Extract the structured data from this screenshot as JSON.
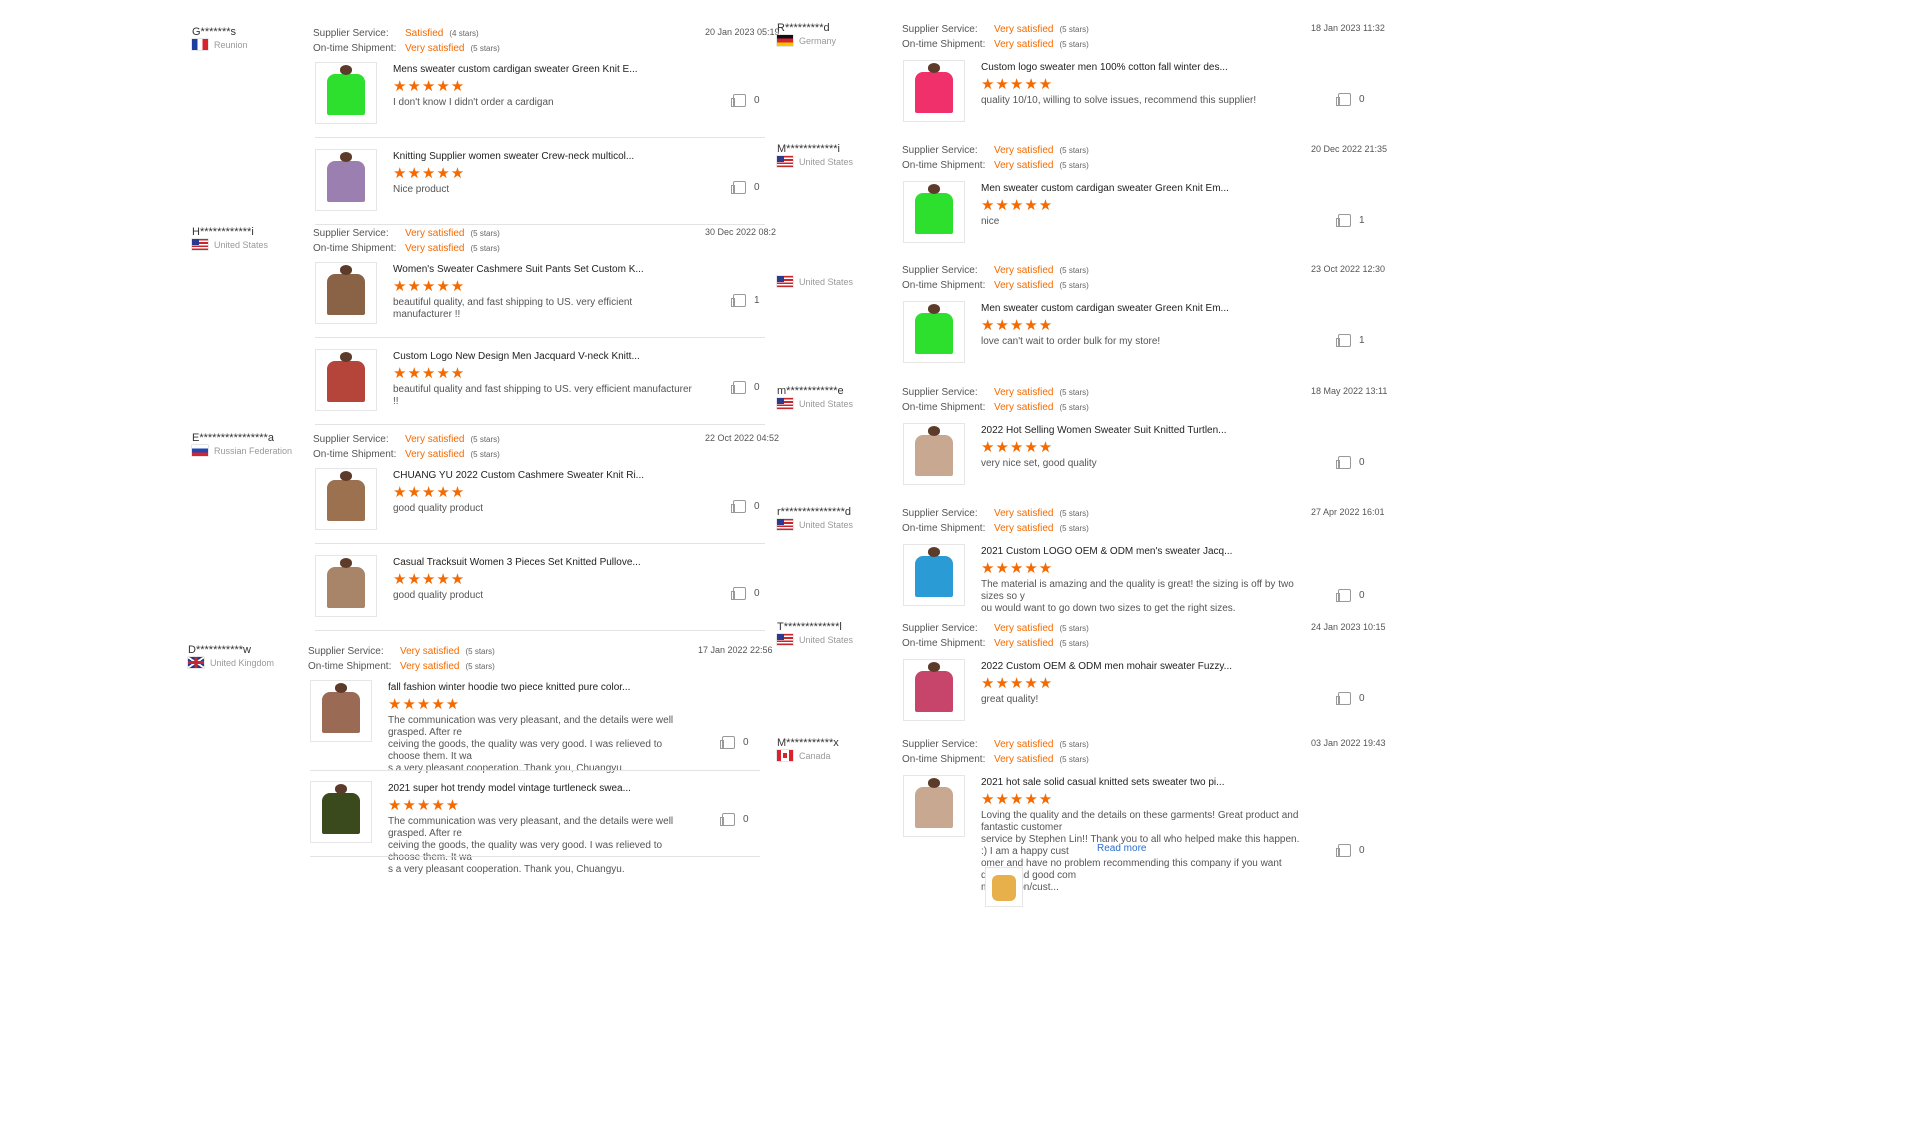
{
  "labels": {
    "supplier_service": "Supplier Service:",
    "ontime_shipment": "On-time Shipment:",
    "read_more": "Read more"
  },
  "colors": {
    "accent": "#f56a00",
    "link": "#2a6fd0"
  },
  "left": [
    {
      "name": "G*******s",
      "country": "Reunion",
      "flag": "fr",
      "service": "Satisfied",
      "service_stars": "(4 stars)",
      "shipment": "Very satisfied",
      "shipment_stars": "(5 stars)",
      "date": "20 Jan 2023 05:19",
      "items": [
        {
          "title": "Mens sweater custom cardigan sweater Green Knit E...",
          "stars": "★★★★★",
          "text": "I don't know I didn't order a cardigan",
          "likes": "0",
          "color": "#2de02d"
        },
        {
          "title": "Knitting Supplier women sweater Crew-neck multicol...",
          "stars": "★★★★★",
          "text": "Nice product",
          "likes": "0",
          "color": "#9b7fb0"
        }
      ]
    },
    {
      "name": "H************i",
      "country": "United States",
      "flag": "us",
      "service": "Very satisfied",
      "service_stars": "(5 stars)",
      "shipment": "Very satisfied",
      "shipment_stars": "(5 stars)",
      "date": "30 Dec 2022 08:2",
      "items": [
        {
          "title": "Women's Sweater Cashmere Suit Pants Set Custom K...",
          "stars": "★★★★★",
          "text": "beautiful quality, and fast shipping to US. very efficient manufacturer !!",
          "likes": "1",
          "color": "#8a6246"
        },
        {
          "title": "Custom Logo New Design Men Jacquard V-neck Knitt...",
          "stars": "★★★★★",
          "text": "beautiful quality and fast shipping to US. very efficient manufacturer !!",
          "likes": "0",
          "color": "#b5453a"
        }
      ]
    },
    {
      "name": "E****************a",
      "country": "Russian Federation",
      "flag": "ru",
      "service": "Very satisfied",
      "service_stars": "(5 stars)",
      "shipment": "Very satisfied",
      "shipment_stars": "(5 stars)",
      "date": "22 Oct 2022 04:52",
      "items": [
        {
          "title": "CHUANG YU 2022 Custom Cashmere Sweater Knit Ri...",
          "stars": "★★★★★",
          "text": "good quality product",
          "likes": "0",
          "color": "#9b7150"
        },
        {
          "title": "Casual Tracksuit Women 3 Pieces Set Knitted Pullove...",
          "stars": "★★★★★",
          "text": "good quality product",
          "likes": "0",
          "color": "#a88468"
        }
      ]
    },
    {
      "name": "D***********w",
      "country": "United Kingdom",
      "flag": "gb",
      "service": "Very satisfied",
      "service_stars": "(5 stars)",
      "shipment": "Very satisfied",
      "shipment_stars": "(5 stars)",
      "date": "17 Jan 2022 22:56",
      "items": [
        {
          "title": "fall fashion winter hoodie two piece knitted pure color...",
          "stars": "★★★★★",
          "text": "The communication was very pleasant, and the details were well grasped. After re\nceiving the goods, the quality was very good. I was relieved to choose them. It wa\ns a very pleasant cooperation. Thank you, Chuangyu.",
          "likes": "0",
          "color": "#9a6a55"
        },
        {
          "title": "2021 super hot trendy model vintage turtleneck swea...",
          "stars": "★★★★★",
          "text": "The communication was very pleasant, and the details were well grasped. After re\nceiving the goods, the quality was very good. I was relieved to choose them. It wa\ns a very pleasant cooperation. Thank you, Chuangyu.",
          "likes": "0",
          "color": "#3b4a1c"
        }
      ]
    }
  ],
  "right_users": [
    {
      "name": "R*********d",
      "country": "Germany",
      "flag": "de"
    },
    {
      "name": "M************i",
      "country": "United States",
      "flag": "us"
    },
    {
      "name": "",
      "country": "United States",
      "flag": "us"
    },
    {
      "name": "m************e",
      "country": "United States",
      "flag": "us"
    },
    {
      "name": "r***************d",
      "country": "United States",
      "flag": "us"
    },
    {
      "name": "T*************l",
      "country": "United States",
      "flag": "us"
    },
    {
      "name": "M***********x",
      "country": "Canada",
      "flag": "ca"
    }
  ],
  "right": [
    {
      "service": "Very satisfied",
      "service_stars": "(5 stars)",
      "shipment": "Very satisfied",
      "shipment_stars": "(5 stars)",
      "date": "18 Jan 2023 11:32",
      "title": "Custom logo sweater men 100% cotton fall winter des...",
      "stars": "★★★★★",
      "text": "quality 10/10, willing to solve issues, recommend this supplier!",
      "likes": "0",
      "color": "#f0306a"
    },
    {
      "service": "Very satisfied",
      "service_stars": "(5 stars)",
      "shipment": "Very satisfied",
      "shipment_stars": "(5 stars)",
      "date": "20 Dec 2022 21:35",
      "title": "Men sweater custom cardigan sweater Green Knit Em...",
      "stars": "★★★★★",
      "text": "nice",
      "likes": "1",
      "color": "#2de02d"
    },
    {
      "service": "Very satisfied",
      "service_stars": "(5 stars)",
      "shipment": "Very satisfied",
      "shipment_stars": "(5 stars)",
      "date": "23 Oct 2022 12:30",
      "title": "Men sweater custom cardigan sweater Green Knit Em...",
      "stars": "★★★★★",
      "text": "love can't wait to order bulk for my store!",
      "likes": "1",
      "color": "#2de02d"
    },
    {
      "service": "Very satisfied",
      "service_stars": "(5 stars)",
      "shipment": "Very satisfied",
      "shipment_stars": "(5 stars)",
      "date": "18 May 2022 13:11",
      "title": "2022 Hot Selling Women Sweater Suit Knitted Turtlen...",
      "stars": "★★★★★",
      "text": "very nice set, good quality",
      "likes": "0",
      "color": "#c9a892"
    },
    {
      "service": "Very satisfied",
      "service_stars": "(5 stars)",
      "shipment": "Very satisfied",
      "shipment_stars": "(5 stars)",
      "date": "27 Apr 2022 16:01",
      "title": "2021 Custom LOGO OEM & ODM men's sweater Jacq...",
      "stars": "★★★★★",
      "text": "The material is amazing and the quality is great! the sizing is off by two sizes so y\nou would want to go down two sizes to get the right sizes.",
      "likes": "0",
      "color": "#2b9bd6"
    },
    {
      "service": "Very satisfied",
      "service_stars": "(5 stars)",
      "shipment": "Very satisfied",
      "shipment_stars": "(5 stars)",
      "date": "24 Jan 2023 10:15",
      "title": "2022 Custom OEM & ODM men mohair sweater Fuzzy...",
      "stars": "★★★★★",
      "text": "great quality!",
      "likes": "0",
      "color": "#c7456a"
    },
    {
      "service": "Very satisfied",
      "service_stars": "(5 stars)",
      "shipment": "Very satisfied",
      "shipment_stars": "(5 stars)",
      "date": "03 Jan 2022 19:43",
      "title": "2021 hot sale solid casual knitted sets sweater two pi...",
      "stars": "★★★★★",
      "text": "Loving the quality and the details on these garments! Great product and fantastic customer\nservice by Stephen Lin!! Thank you to all who helped make this happen. :) I am a happy cust\nomer and have no problem recommending this company if you want quality and good com\nmunication/cust...",
      "likes": "0",
      "color": "#c9a892",
      "read_more": true,
      "extra_photo_color": "#e8b04a"
    }
  ]
}
